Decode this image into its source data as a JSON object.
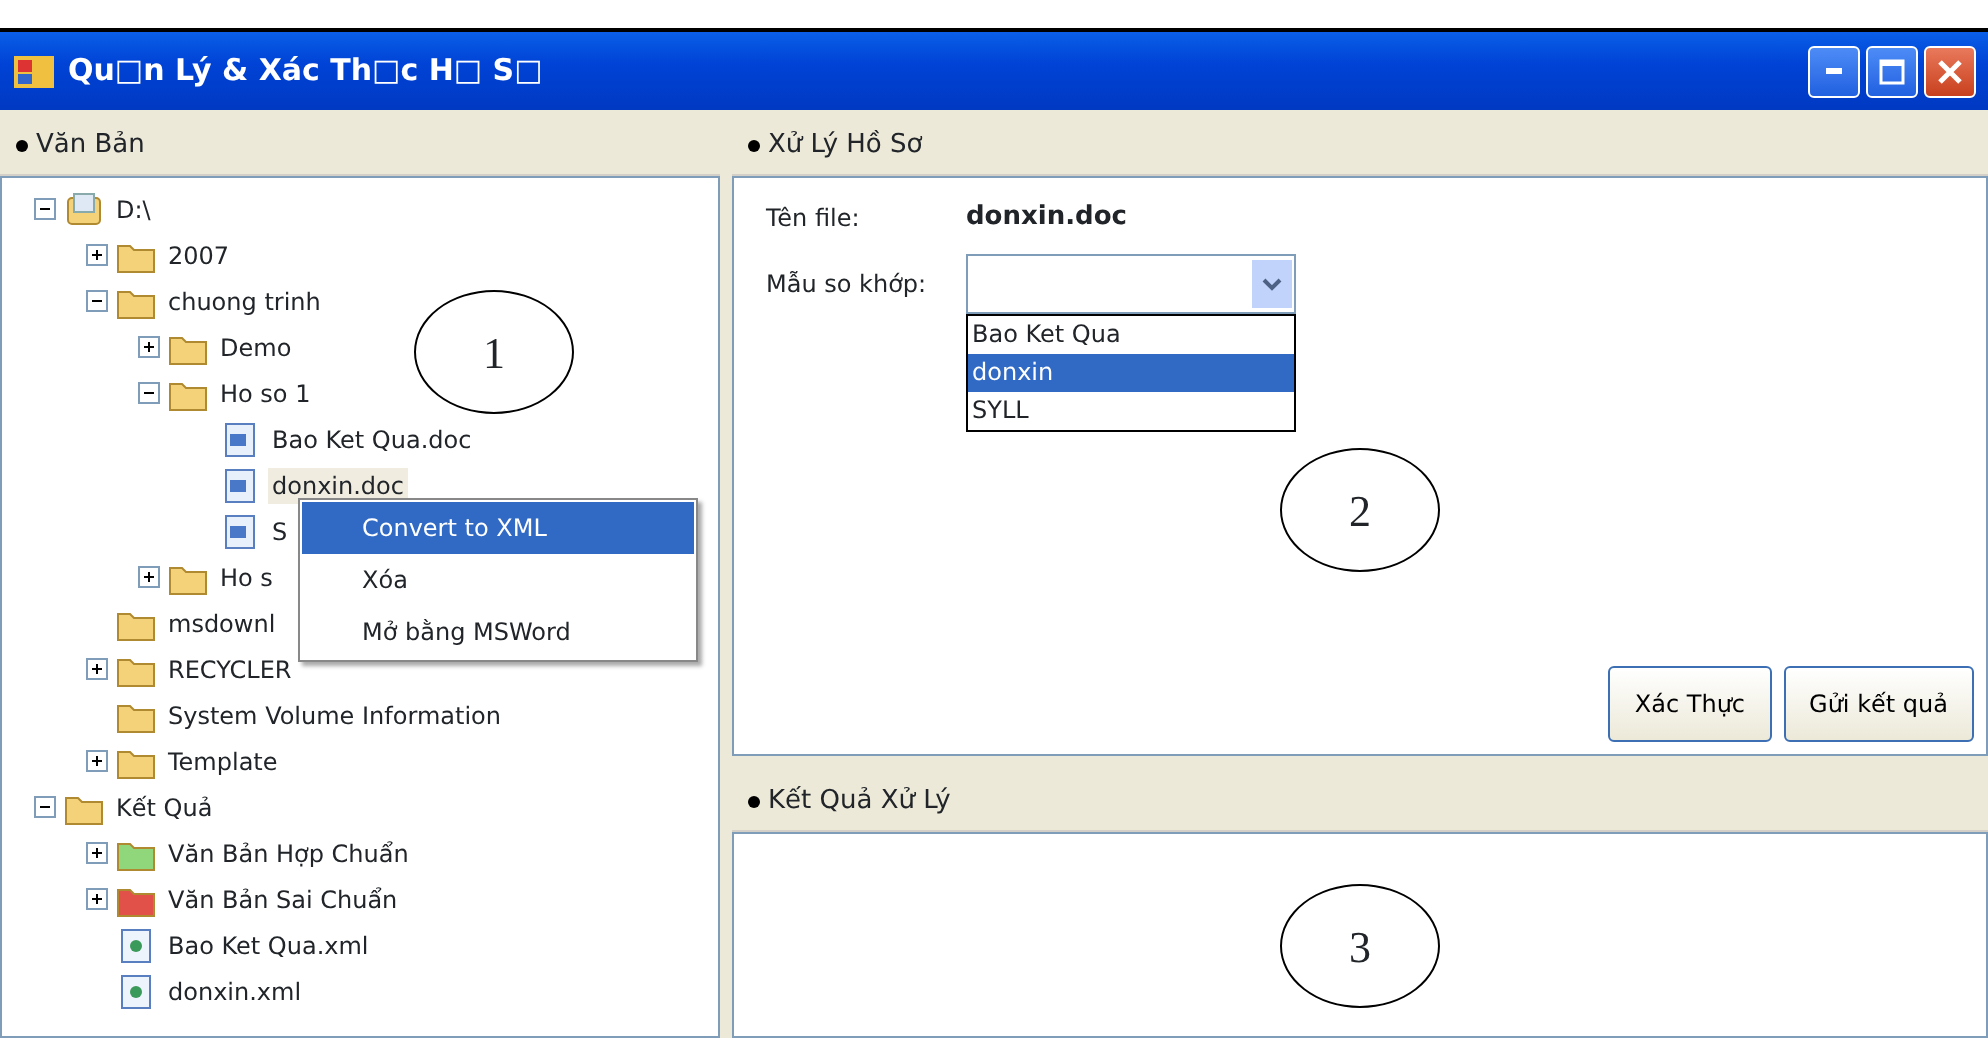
{
  "window": {
    "title": "Qu□n Lý & Xác Th□c H□ S□"
  },
  "left_panel": {
    "title": "Văn Bản",
    "annotation": "1",
    "tree": [
      {
        "label": "D:\\",
        "kind": "drive",
        "expanded": true,
        "selected": false,
        "children": [
          {
            "label": "2007",
            "kind": "folder",
            "expanded": false,
            "selected": false
          },
          {
            "label": "chuong trinh",
            "kind": "folder",
            "expanded": true,
            "selected": false,
            "children": [
              {
                "label": "Demo",
                "kind": "folder",
                "expanded": false,
                "selected": false
              },
              {
                "label": "Ho so 1",
                "kind": "folder",
                "expanded": true,
                "selected": false,
                "children": [
                  {
                    "label": "Bao Ket Qua.doc",
                    "kind": "doc",
                    "selected": false
                  },
                  {
                    "label": "donxin.doc",
                    "kind": "doc",
                    "selected": true
                  },
                  {
                    "label": "S",
                    "kind": "doc",
                    "selected": false
                  }
                ]
              },
              {
                "label": "Ho s",
                "kind": "folder",
                "expanded": false,
                "selected": false
              }
            ]
          },
          {
            "label": "msdownl",
            "kind": "folder",
            "selected": false
          },
          {
            "label": "RECYCLER",
            "kind": "folder",
            "expanded": false,
            "selected": false
          },
          {
            "label": "System Volume Information",
            "kind": "folder",
            "selected": false
          },
          {
            "label": "Template",
            "kind": "folder",
            "expanded": false,
            "selected": false
          }
        ]
      },
      {
        "label": "Kết Quả",
        "kind": "folder",
        "expanded": true,
        "selected": false,
        "children": [
          {
            "label": "Văn Bản Hợp Chuẩn",
            "kind": "folder",
            "color": "#8fd77a",
            "expanded": false,
            "selected": false
          },
          {
            "label": "Văn Bản Sai Chuẩn",
            "kind": "folder",
            "color": "#e2504a",
            "expanded": false,
            "selected": false
          },
          {
            "label": "Bao Ket Qua.xml",
            "kind": "xml",
            "selected": false
          },
          {
            "label": "donxin.xml",
            "kind": "xml",
            "selected": false
          }
        ]
      }
    ]
  },
  "context_menu": {
    "items": [
      {
        "label": "Convert to XML",
        "selected": true
      },
      {
        "label": "Xóa",
        "selected": false
      },
      {
        "label": "Mở bằng MSWord",
        "selected": false
      }
    ]
  },
  "process_panel": {
    "title": "Xử Lý Hồ Sơ",
    "file_label": "Tên file:",
    "file_name": "donxin.doc",
    "template_label": "Mẫu so khớp:",
    "template_options": [
      {
        "label": "Bao Ket Qua",
        "selected": false
      },
      {
        "label": "donxin",
        "selected": true
      },
      {
        "label": "SYLL",
        "selected": false
      }
    ],
    "annotation": "2",
    "buttons": [
      "Xác Thực",
      "Gửi kết quả"
    ]
  },
  "result_panel": {
    "title": "Kết Quả Xử Lý",
    "annotation": "3"
  }
}
